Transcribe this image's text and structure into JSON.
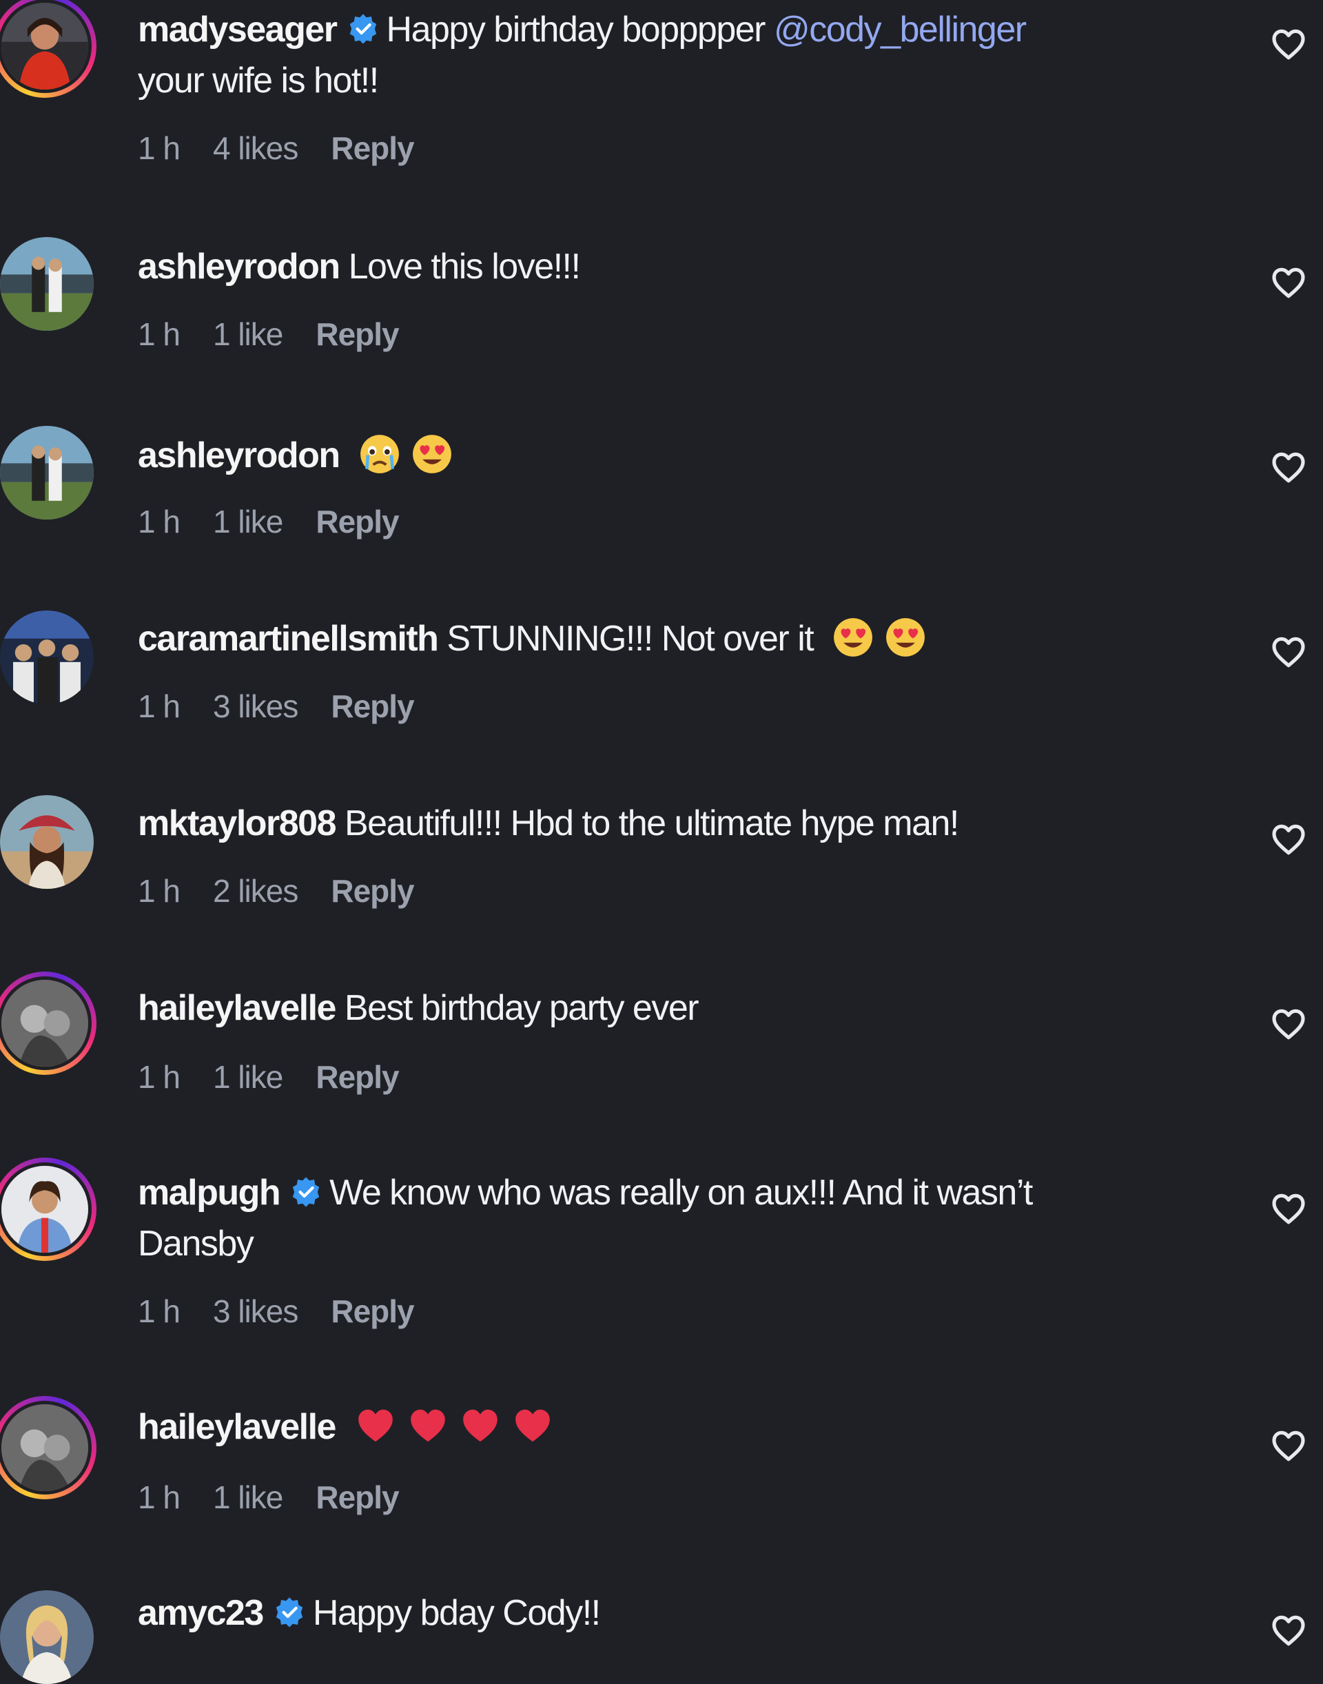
{
  "comments": [
    {
      "username": "madyseager",
      "verified": true,
      "text": "Happy birthday bopppper",
      "mention": "@cody_bellinger",
      "text2": "your wife is hot!!",
      "time": "1 h",
      "likes": "4 likes",
      "reply": "Reply",
      "avatar": "woman-red-dress",
      "story": true,
      "emojis": []
    },
    {
      "username": "ashleyrodon",
      "verified": false,
      "text": "Love this love!!!",
      "time": "1 h",
      "likes": "1 like",
      "reply": "Reply",
      "avatar": "couple-baseball-field",
      "story": false,
      "emojis": []
    },
    {
      "username": "ashleyrodon",
      "verified": false,
      "text": "",
      "time": "1 h",
      "likes": "1 like",
      "reply": "Reply",
      "avatar": "couple-baseball-field",
      "story": false,
      "emojis": [
        "crying-face-emoji",
        "heart-eyes-emoji"
      ]
    },
    {
      "username": "caramartinellsmith",
      "verified": false,
      "text": "STUNNING!!! Not over it",
      "time": "1 h",
      "likes": "3 likes",
      "reply": "Reply",
      "avatar": "group-photo",
      "story": false,
      "emojis": [
        "heart-eyes-emoji",
        "heart-eyes-emoji"
      ]
    },
    {
      "username": "mktaylor808",
      "verified": false,
      "text": "Beautiful!!! Hbd to the ultimate hype man!",
      "time": "1 h",
      "likes": "2 likes",
      "reply": "Reply",
      "avatar": "woman-red-hat",
      "story": false,
      "emojis": []
    },
    {
      "username": "haileylavelle",
      "verified": false,
      "text": "Best birthday party ever",
      "time": "1 h",
      "likes": "1 like",
      "reply": "Reply",
      "avatar": "bw-couple",
      "story": true,
      "emojis": []
    },
    {
      "username": "malpugh",
      "verified": true,
      "text": "We know who was really on aux!!! And it wasn’t",
      "text2": "Dansby",
      "time": "1 h",
      "likes": "3 likes",
      "reply": "Reply",
      "avatar": "woman-blue-jersey",
      "story": true,
      "emojis": []
    },
    {
      "username": "haileylavelle",
      "verified": false,
      "text": "",
      "time": "1 h",
      "likes": "1 like",
      "reply": "Reply",
      "avatar": "bw-couple",
      "story": true,
      "emojis": [
        "red-heart-emoji",
        "red-heart-emoji",
        "red-heart-emoji",
        "red-heart-emoji"
      ]
    },
    {
      "username": "amyc23",
      "verified": true,
      "text": "Happy bday Cody!!",
      "time": "",
      "likes": "",
      "reply": "",
      "avatar": "blonde-woman",
      "story": false,
      "emojis": []
    }
  ],
  "colors": {
    "background": "#1f2025",
    "text": "#f1f2f4",
    "meta": "#9ba1ad",
    "mention": "#93a8f0",
    "verified": "#3897f0"
  }
}
